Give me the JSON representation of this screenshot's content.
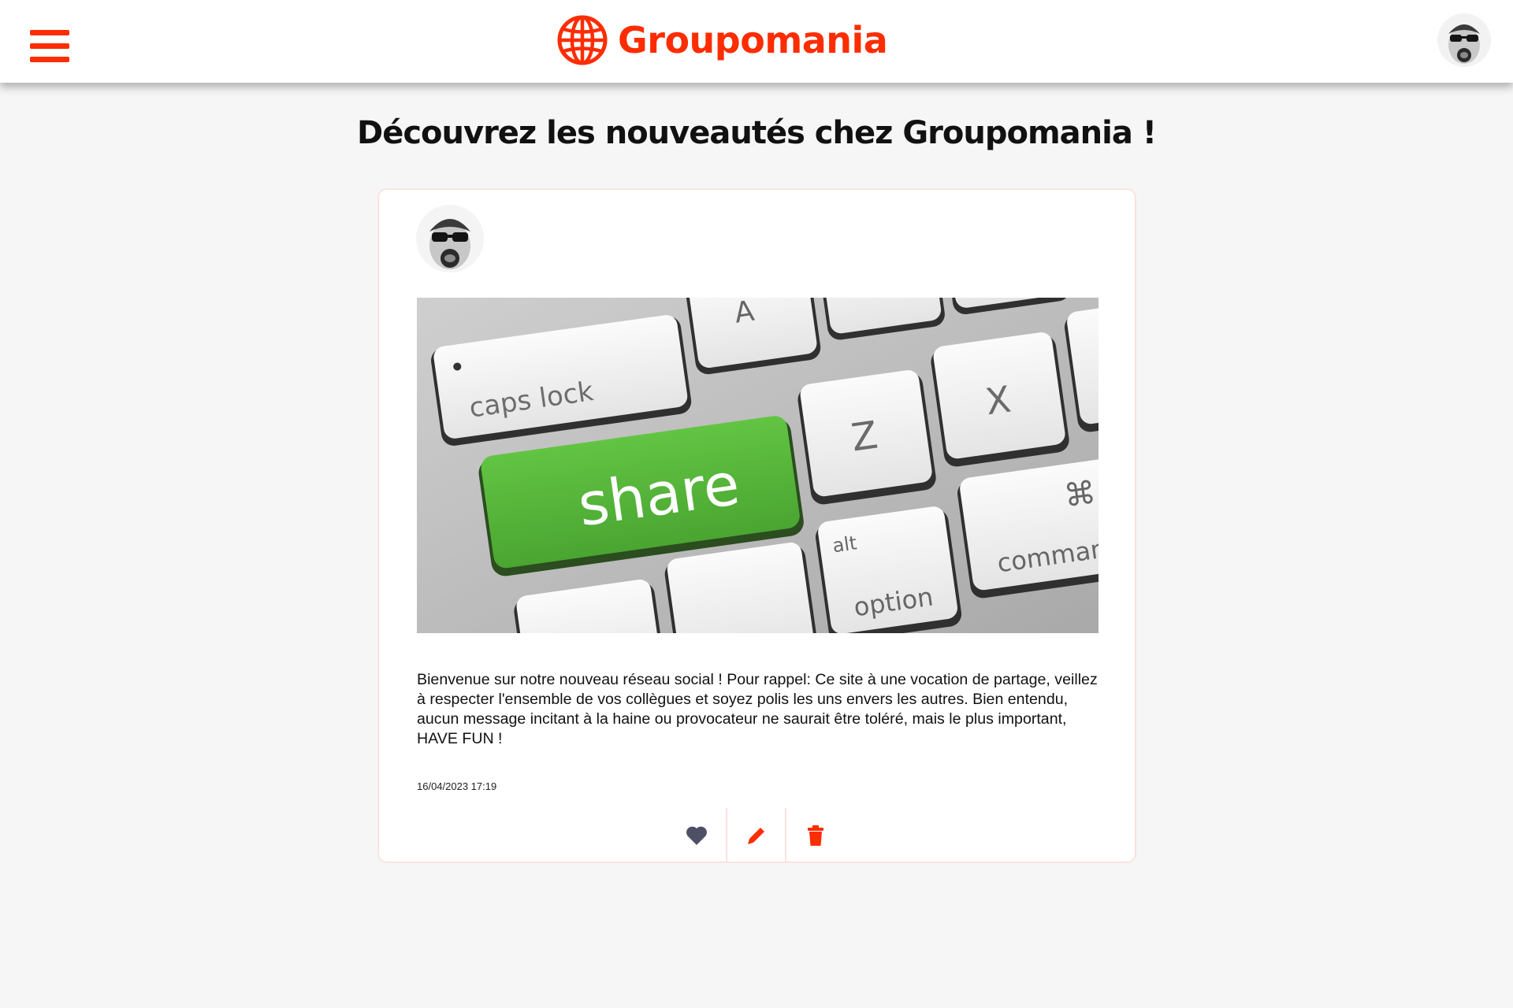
{
  "header": {
    "brand_name": "Groupomania",
    "menu_icon": "hamburger-menu-icon",
    "logo_icon": "globe-icon",
    "avatar_icon": "user-avatar"
  },
  "page": {
    "title": "Découvrez les nouveautés chez Groupomania !"
  },
  "post": {
    "author_avatar": "user-avatar",
    "image_keys": [
      "caps lock",
      "share",
      "Z",
      "X",
      "alt",
      "option",
      "comman",
      "A",
      "⌘"
    ],
    "text": "Bienvenue sur notre nouveau réseau social ! Pour rappel: Ce site à une vocation de partage, veillez à respecter l'ensemble de vos collègues et soyez polis les uns envers les autres. Bien entendu, aucun message incitant à la haine ou provocateur ne saurait être toléré, mais le plus important, HAVE FUN !",
    "date": "16/04/2023 17:19",
    "actions": [
      {
        "icon": "heart-icon"
      },
      {
        "icon": "pencil-icon"
      },
      {
        "icon": "trash-icon"
      }
    ]
  },
  "colors": {
    "accent": "#fd2d01",
    "like": "#4e5166",
    "share_key": "#58b83a",
    "background": "#f6f6f7"
  }
}
